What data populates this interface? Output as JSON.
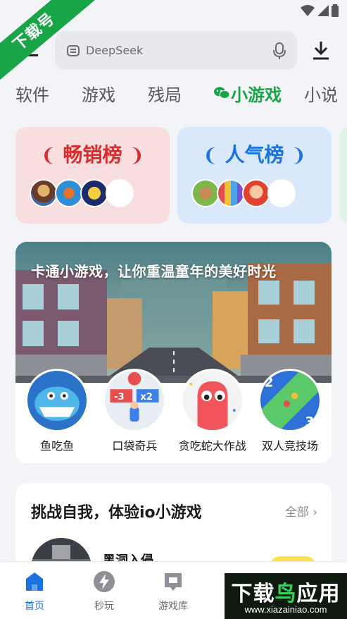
{
  "watermark_corner": "下载号",
  "search": {
    "text": "DeepSeek"
  },
  "tabs": [
    {
      "label": "软件"
    },
    {
      "label": "游戏"
    },
    {
      "label": "残局"
    },
    {
      "label": "小游戏",
      "active": true
    },
    {
      "label": "小说"
    }
  ],
  "rank_cards": [
    {
      "title": "畅销榜",
      "color": "#dd2b2b"
    },
    {
      "title": "人气榜",
      "color": "#1b73e3"
    }
  ],
  "banner": {
    "title": "卡通小游戏，让你重温童年的美好时光",
    "games": [
      {
        "name": "鱼吃鱼",
        "icon": "shark-icon"
      },
      {
        "name": "口袋奇兵",
        "icon": "soldier-icon"
      },
      {
        "name": "贪吃蛇大作战",
        "icon": "snake-icon"
      },
      {
        "name": "双人竞技场",
        "icon": "versus-icon"
      }
    ]
  },
  "io_section": {
    "title": "挑战自我，体验io小游戏",
    "more": "全部 ›",
    "first_game": "黑洞入侵"
  },
  "bottom_nav": [
    {
      "label": "首页",
      "icon": "home-icon",
      "active": true
    },
    {
      "label": "秒玩",
      "icon": "lightning-icon"
    },
    {
      "label": "游戏库",
      "icon": "library-icon"
    }
  ],
  "watermark_bottom": {
    "main_white": "下载",
    "main_green": "鸟",
    "main_white2": "应用",
    "url": "www.xiazainiao.com"
  },
  "colors": {
    "accent_green": "#18a548",
    "accent_blue": "#1b73e3",
    "accent_red": "#dd2b2b"
  }
}
